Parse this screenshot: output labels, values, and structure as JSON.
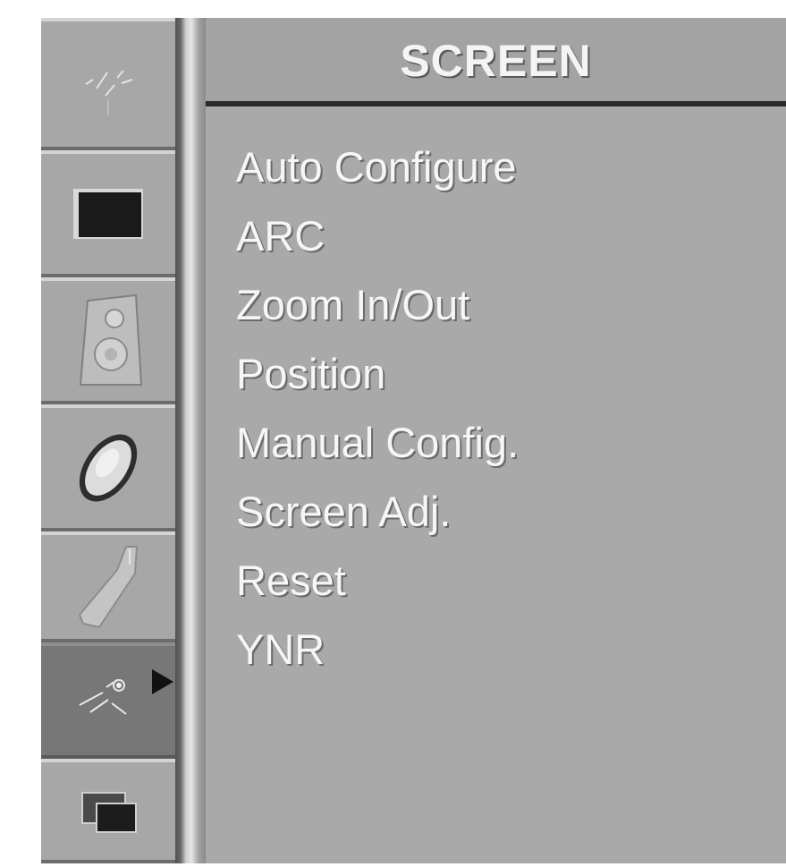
{
  "menu": {
    "title": "SCREEN",
    "items": [
      {
        "label": "Auto Configure"
      },
      {
        "label": "ARC"
      },
      {
        "label": "Zoom In/Out"
      },
      {
        "label": "Position"
      },
      {
        "label": "Manual Config."
      },
      {
        "label": "Screen Adj."
      },
      {
        "label": "Reset"
      },
      {
        "label": "YNR"
      }
    ]
  },
  "sidebar": {
    "items": [
      {
        "icon": "satellite-dish-icon",
        "selected": false
      },
      {
        "icon": "picture-icon",
        "selected": false
      },
      {
        "icon": "speaker-icon",
        "selected": false
      },
      {
        "icon": "clock-icon",
        "selected": false
      },
      {
        "icon": "wrench-icon",
        "selected": false
      },
      {
        "icon": "screen-settings-icon",
        "selected": true
      },
      {
        "icon": "pip-icon",
        "selected": false
      }
    ]
  },
  "colors": {
    "osd_background": "#a9a9a9",
    "selected_item": "#777777",
    "text": "#f6f6f6"
  }
}
